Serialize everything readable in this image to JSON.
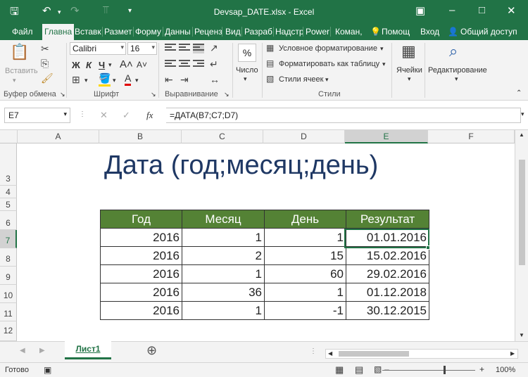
{
  "titlebar": {
    "title": "Devsap_DATE.xlsx - Excel",
    "save_icon": "save-icon",
    "undo_icon": "undo-icon",
    "redo_icon": "redo-icon"
  },
  "tabs": [
    "Файл",
    "Главна",
    "Вставк",
    "Размет",
    "Форму",
    "Данны",
    "Реценз",
    "Вид",
    "Разраб",
    "Надстр",
    "Power",
    "Коман,"
  ],
  "tell_me": "Помощ",
  "signin": "Вход",
  "share": "Общий доступ",
  "ribbon": {
    "paste_label": "Вставить",
    "clipboard_label": "Буфер обмена",
    "font_name": "Calibri",
    "font_size": "16",
    "font_label": "Шрифт",
    "bold": "Ж",
    "italic": "К",
    "underline": "Ч",
    "alignment_label": "Выравнивание",
    "number_label": "Число",
    "percent": "%",
    "cond_format": "Условное форматирование",
    "format_table": "Форматировать как таблицу",
    "cell_styles": "Стили ячеек",
    "styles_label": "Стили",
    "cells_label": "Ячейки",
    "editing_label": "Редактирование"
  },
  "formula_bar": {
    "name_box": "E7",
    "formula": "=ДАТА(B7;C7;D7)",
    "fx": "fx"
  },
  "columns": [
    "A",
    "B",
    "C",
    "D",
    "E",
    "F"
  ],
  "rows": [
    "3",
    "4",
    "5",
    "6",
    "7",
    "8",
    "9",
    "10",
    "11",
    "12"
  ],
  "sheet_title": "Дата (год;месяц;день)",
  "table": {
    "headers": [
      "Год",
      "Месяц",
      "День",
      "Результат"
    ],
    "rows": [
      [
        "2016",
        "1",
        "1",
        "01.01.2016"
      ],
      [
        "2016",
        "2",
        "15",
        "15.02.2016"
      ],
      [
        "2016",
        "1",
        "60",
        "29.02.2016"
      ],
      [
        "2016",
        "36",
        "1",
        "01.12.2018"
      ],
      [
        "2016",
        "1",
        "-1",
        "30.12.2015"
      ]
    ]
  },
  "sheet_tab": "Лист1",
  "status": {
    "ready": "Готово",
    "zoom": "100%"
  },
  "colors": {
    "excel_green": "#217346",
    "header_fill": "#548235",
    "title_text": "#1f3864"
  }
}
